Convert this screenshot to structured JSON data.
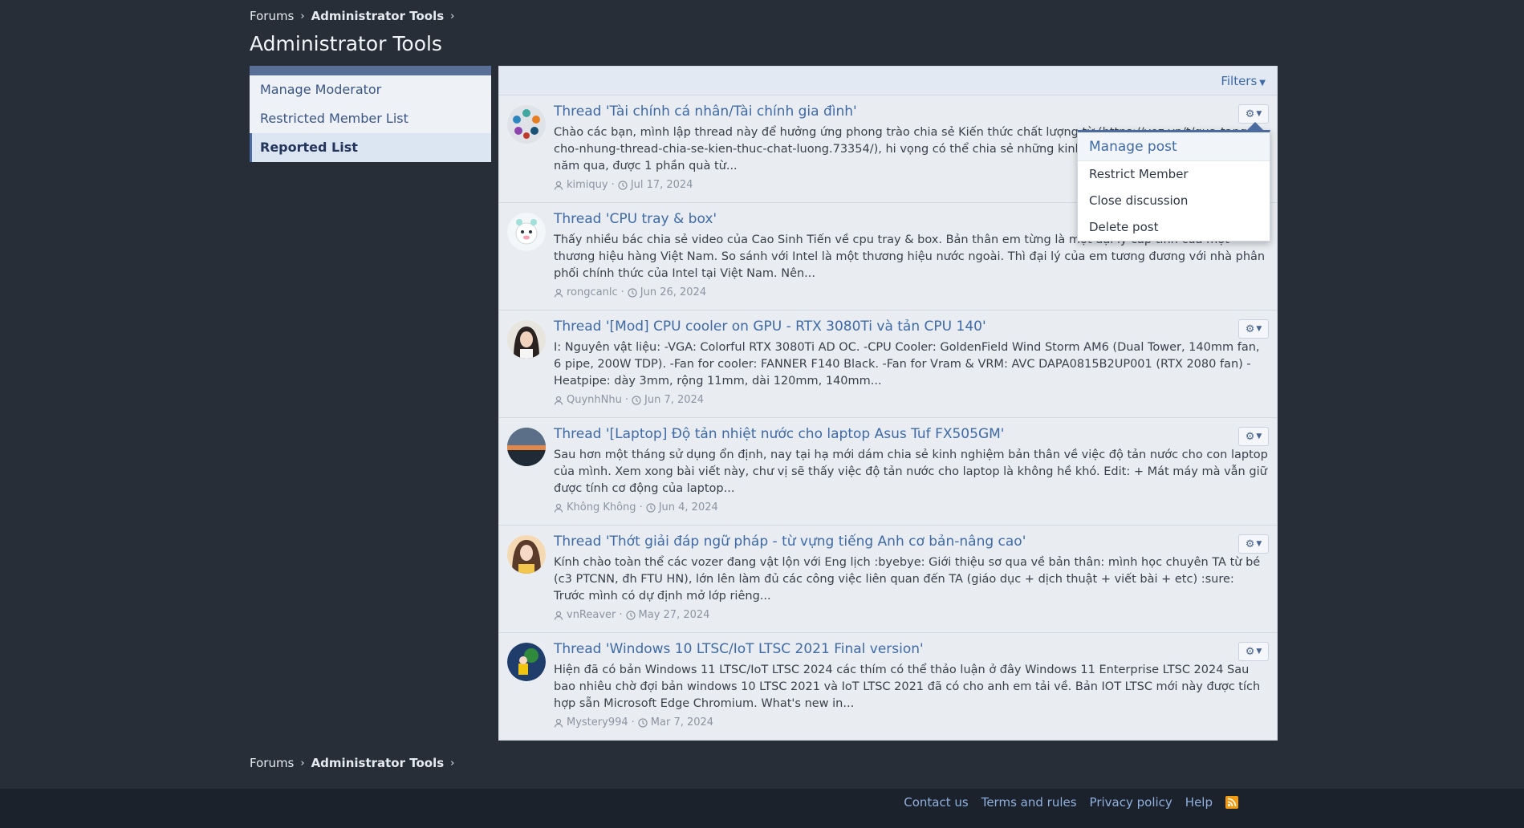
{
  "breadcrumb": {
    "forums": "Forums",
    "admin_tools": "Administrator Tools"
  },
  "page": {
    "title": "Administrator Tools"
  },
  "sidebar": {
    "items": [
      {
        "label": "Manage Moderator",
        "active": false
      },
      {
        "label": "Restricted Member List",
        "active": false
      },
      {
        "label": "Reported List",
        "active": true
      }
    ]
  },
  "main": {
    "filters_label": "Filters",
    "items": [
      {
        "title": "Thread 'Tài chính cá nhân/Tài chính gia đình'",
        "body": "Chào các bạn, mình lập thread này để hưởng ứng phong trào chia sẻ Kiến thức chất lượng từ (https://voz.vn/t/qua-tang-cho-nhung-thread-chia-se-kien-thuc-chat-luong.73354/), hi vọng có thể chia sẻ những kinh nghiệm tích lũy trong suốt 4 năm qua, được 1 phần quà từ...",
        "author": "kimiquy",
        "date": "Jul 17, 2024"
      },
      {
        "title": "Thread 'CPU tray & box'",
        "body": "Thấy nhiều bác chia sẻ video của Cao Sinh Tiến về cpu tray & box. Bản thân em từng là một đại lý cấp tỉnh của một thương hiệu hàng Việt Nam. So sánh với Intel là một thương hiệu nước ngoài. Thì đại lý của em tương đương với nhà phân phối chính thức của Intel tại Việt Nam. Nên...",
        "author": "rongcanlc",
        "date": "Jun 26, 2024"
      },
      {
        "title": "Thread '[Mod] CPU cooler on GPU - RTX 3080Ti và tản CPU 140'",
        "body": "I: Nguyên vật liệu: -VGA: Colorful RTX 3080Ti AD OC. -CPU Cooler: GoldenField Wind Storm AM6 (Dual Tower, 140mm fan, 6 pipe, 200W TDP). -Fan for cooler: FANNER F140 Black. -Fan for Vram & VRM: AVC DAPA0815B2UP001 (RTX 2080 fan) -Heatpipe: dày 3mm, rộng 11mm, dài 120mm, 140mm...",
        "author": "QuynhNhu",
        "date": "Jun 7, 2024"
      },
      {
        "title": "Thread '[Laptop] Độ tản nhiệt nước cho laptop Asus Tuf FX505GM'",
        "body": "Sau hơn một tháng sử dụng ổn định, nay tại hạ mới dám chia sẻ kinh nghiệm bản thân về việc độ tản nước cho con laptop của mình. Xem xong bài viết này, chư vị sẽ thấy việc độ tản nước cho laptop là không hề khó. Edit: + Mát máy mà vẫn giữ được tính cơ động của laptop...",
        "author": "Không Không",
        "date": "Jun 4, 2024"
      },
      {
        "title": "Thread 'Thớt giải đáp ngữ pháp - từ vựng tiếng Anh cơ bản-nâng cao'",
        "body": "Kính chào toàn thể các vozer đang vật lộn với Eng lịch :byebye: Giới thiệu sơ qua về bản thân: mình học chuyên TA từ bé (c3 PTCNN, đh FTU HN), lớn lên làm đủ các công việc liên quan đến TA (giáo dục + dịch thuật + viết bài + etc) :sure: Trước mình có dự định mở lớp riêng...",
        "author": "vnReaver",
        "date": "May 27, 2024"
      },
      {
        "title": "Thread 'Windows 10 LTSC/IoT LTSC 2021 Final version'",
        "body": "Hiện đã có bản Windows 11 LTSC/IoT LTSC 2024 các thím có thể thảo luận ở đây Windows 11 Enterprise LTSC 2024 Sau bao nhiêu chờ đợi bản windows 10 LTSC 2021 và IoT LTSC 2021 đã có cho anh em tải về. Bản IOT LTSC mới này được tích hợp sẵn Microsoft Edge Chromium. What's new in...",
        "author": "Mystery994",
        "date": "Mar 7, 2024"
      }
    ]
  },
  "dropdown": {
    "header": "Manage post",
    "items": [
      "Restrict Member",
      "Close discussion",
      "Delete post"
    ]
  },
  "footer": {
    "links": [
      "Contact us",
      "Terms and rules",
      "Privacy policy",
      "Help"
    ]
  },
  "icons": {
    "gear": "gear-icon",
    "caret": "chevron-down-icon",
    "user": "user-icon",
    "clock": "clock-icon",
    "rss": "rss-icon"
  },
  "colors": {
    "background": "#272e38",
    "link": "#3e6aa7",
    "accent": "#4b6aa0",
    "footer": "#1c222b",
    "rss": "#f39c12"
  }
}
